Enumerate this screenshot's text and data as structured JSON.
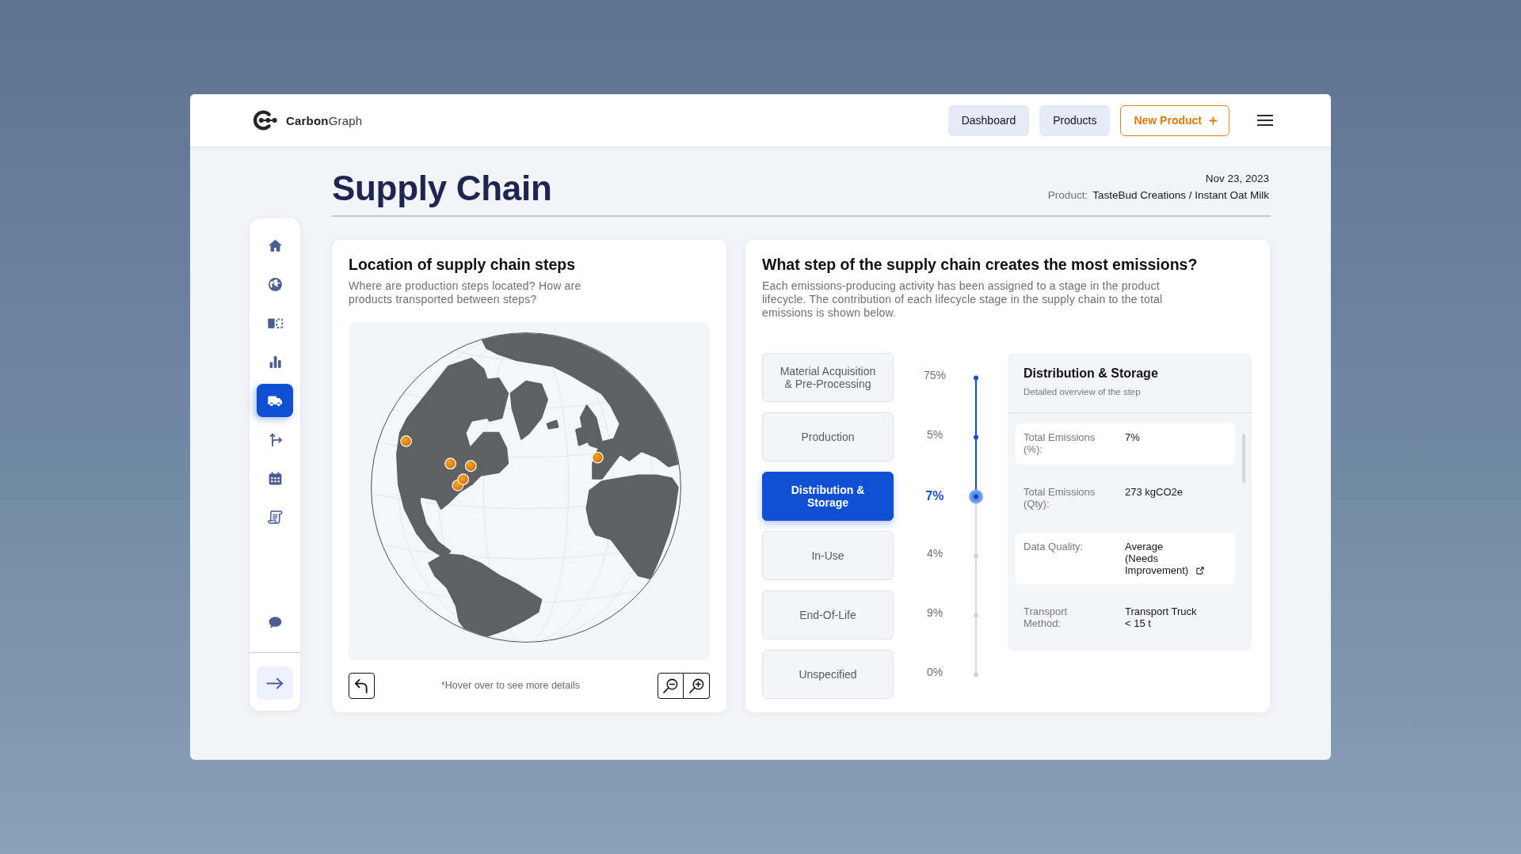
{
  "header": {
    "logo": "**Carbon**Graph",
    "nav": [
      {
        "label": "Dashboard",
        "kind": "secondary"
      },
      {
        "label": "Products",
        "kind": "secondary"
      },
      {
        "label": "New Product",
        "kind": "primary"
      }
    ]
  },
  "sidebar": {
    "items": [
      {
        "selected": false
      },
      {
        "selected": false
      },
      {
        "selected": false
      },
      {
        "selected": false
      },
      {
        "selected": true
      },
      {
        "selected": false
      },
      {
        "selected": false
      },
      {
        "selected": false
      }
    ],
    "footer_items": [
      {
        "selected": false
      }
    ]
  },
  "page": {
    "title": "Supply Chain",
    "date": "Nov 23, 2023",
    "product_label": "Product:",
    "product_name": "TasteBud Creations / Instant Oat Milk"
  },
  "location_card": {
    "title": "Location of supply chain steps",
    "subtitle": "Where are production steps located? How are products transported between steps?",
    "hint": "*Hover over to see more details"
  },
  "emissions_card": {
    "title": "What step of the supply chain creates the most emissions?",
    "description": "Each emissions-producing activity has been assigned to a stage in the product lifecycle. The contribution of each lifecycle stage in the supply chain to the total emissions is shown below.",
    "steps": [
      {
        "label": "Material Acquisition & Pre-Processing",
        "share": "75%",
        "selected": false
      },
      {
        "label": "Production",
        "share": "5%",
        "selected": false
      },
      {
        "label": "Distribution & Storage",
        "share": "7%",
        "selected": true
      },
      {
        "label": "In-Use",
        "share": "4%",
        "selected": false
      },
      {
        "label": "End-Of-Life",
        "share": "9%",
        "selected": false
      },
      {
        "label": "Unspecified",
        "share": "0%",
        "selected": false
      }
    ],
    "details": {
      "title": "Distribution & Storage",
      "subtitle": "Detailed overview of the step",
      "rows": [
        {
          "label": "Total Emissions (%):",
          "value": "7%",
          "link": false
        },
        {
          "label": "Total Emissions (Qty):",
          "value": "273 kgCO2e",
          "link": false
        },
        {
          "label": "Data Quality:",
          "value": "Average (Needs Improvement)",
          "link": true
        },
        {
          "label": "Transport Method:",
          "value": "Transport Truck < 15 t",
          "link": false
        }
      ]
    }
  }
}
